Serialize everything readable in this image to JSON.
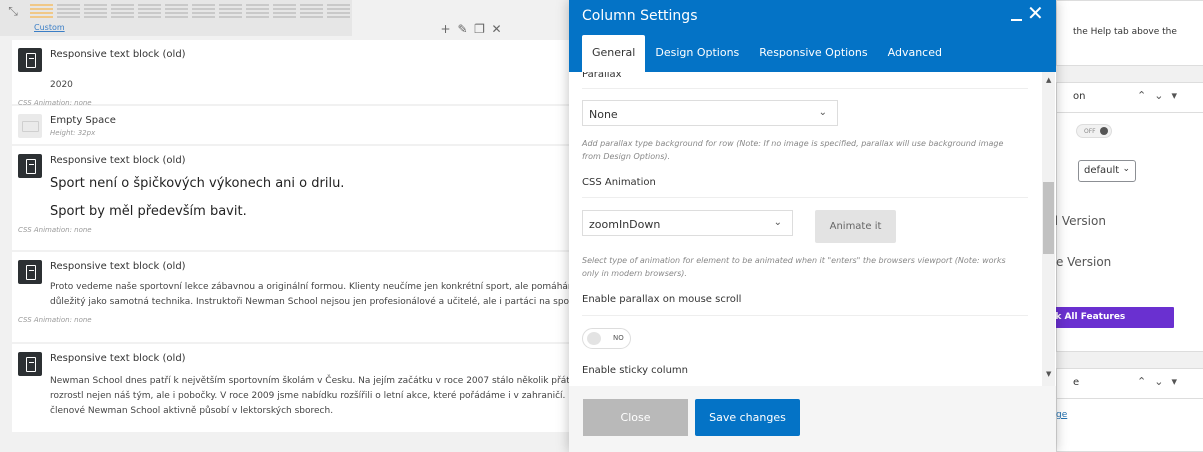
{
  "editor": {
    "custom_link": "Custom",
    "elements": [
      {
        "title": "Responsive text block (old)",
        "body": [
          "2020"
        ],
        "meta": "CSS Animation: none"
      },
      {
        "title": "Empty Space",
        "sub": "Height: 32px"
      },
      {
        "title": "Responsive text block (old)",
        "body": [
          "Sport není o špičkových výkonech ani o drilu.",
          "Sport by měl především bavit."
        ],
        "meta": "CSS Animation: none"
      },
      {
        "title": "Responsive text block (old)",
        "body": [
          "Proto vedeme naše sportovní lekce zábavnou a originální formou. Klienty neučíme jen konkrétní sport, ale pomáháme jim",
          "důležitý jako samotná technika. Instruktoři Newman School nejsou jen profesionálové a učitelé, ale i partáci na sport, kter"
        ],
        "meta": "CSS Animation: none"
      },
      {
        "title": "Responsive text block (old)",
        "body": [
          "Newman School dnes patří k největším sportovním školám v Česku. Na jejím začátku v roce 2007 stálo několik přátel, kte",
          "rozrostl nejen náš tým, ale i pobočky. V roce 2009 jsme nabídku rozšířili o letní akce, které pořádáme i v zahraničí. Naši pr",
          "členové Newman School aktivně působí v lektorských sborech."
        ]
      }
    ]
  },
  "sidebar": {
    "help_text": "the Help tab above the",
    "panel1_title": "on",
    "toggle_label": "OFF",
    "select_value": "default",
    "text1": "ed Version",
    "text2": "ble Version",
    "unlock_label": "ck All Features",
    "panel2_title": "e",
    "link": "ge"
  },
  "modal": {
    "title": "Column Settings",
    "tabs": [
      "General",
      "Design Options",
      "Responsive Options",
      "Advanced"
    ],
    "active_tab": 0,
    "parallax_label": "Parallax",
    "parallax_value": "None",
    "parallax_help": [
      "Add parallax type background for row (Note: If no image is specified, parallax will use background image",
      "from Design Options)."
    ],
    "animation_label": "CSS Animation",
    "animation_value": "zoomInDown",
    "animate_button": "Animate it",
    "animation_help": [
      "Select type of animation for element to be animated when it \"enters\" the browsers viewport (Note: works",
      "only in modern browsers)."
    ],
    "mouse_parallax_label": "Enable parallax on mouse scroll",
    "mouse_parallax_toggle": "NO",
    "sticky_label": "Enable sticky column",
    "close_button": "Close",
    "save_button": "Save changes"
  },
  "colors": {
    "primary_blue": "#0473c6",
    "unlock_purple": "#6a30d0",
    "close_gray": "#b9b9b9"
  }
}
